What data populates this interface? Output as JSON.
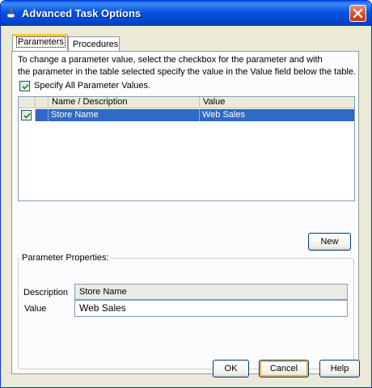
{
  "window": {
    "title": "Advanced Task Options"
  },
  "tabs": [
    {
      "label": "Parameters",
      "active": true
    },
    {
      "label": "Procedures",
      "active": false
    }
  ],
  "instructions": {
    "line1": "To change a parameter value, select the checkbox for the parameter and with",
    "line2": "the parameter in the table selected specify the value in the Value field below the table."
  },
  "specify_all": {
    "label": "Specify All Parameter Values.",
    "checked": true
  },
  "table": {
    "columns": [
      "",
      "Name / Description",
      "Value"
    ],
    "rows": [
      {
        "checked": true,
        "name": "Store Name",
        "value": "Web Sales",
        "selected": true
      }
    ]
  },
  "new_button": {
    "label": "New"
  },
  "properties": {
    "title": "Parameter Properties:",
    "description_label": "Description",
    "description_value": "Store Name",
    "value_label": "Value",
    "value_value": "Web Sales"
  },
  "footer": {
    "ok_label": "OK",
    "cancel_label": "Cancel",
    "help_label": "Help"
  },
  "colors": {
    "titlebar": "#0553e0",
    "selection": "#3169c6",
    "checkmark": "#21a121",
    "close_button": "#d34b22"
  }
}
